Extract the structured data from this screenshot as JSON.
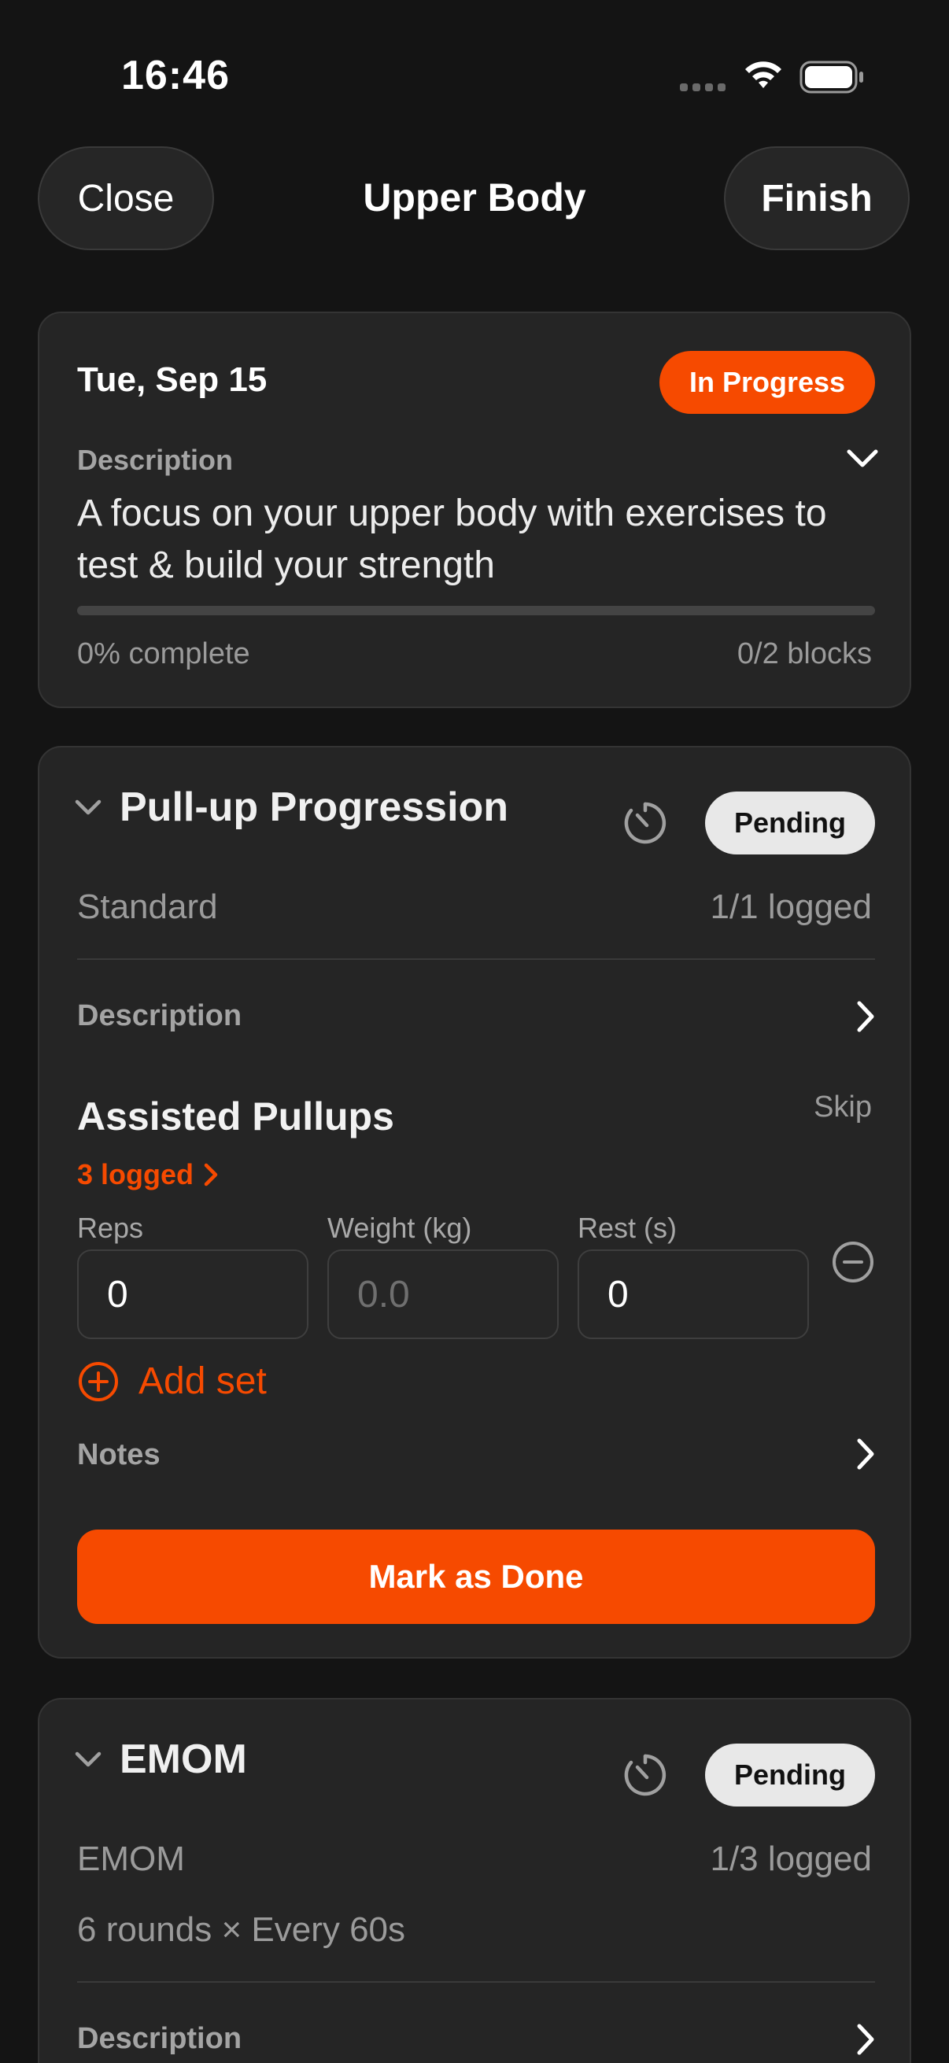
{
  "status_bar": {
    "time": "16:46"
  },
  "nav": {
    "close_label": "Close",
    "title": "Upper Body",
    "finish_label": "Finish"
  },
  "summary": {
    "date": "Tue, Sep 15",
    "status": "In Progress",
    "description_label": "Description",
    "description": "A focus on your upper body with exercises to test & build your strength",
    "progress_fraction": 0,
    "progress_text": "0% complete",
    "blocks_text": "0/2 blocks"
  },
  "blocks": [
    {
      "title": "Pull-up Progression",
      "status": "Pending",
      "type": "Standard",
      "logged": "1/1 logged",
      "description_label": "Description",
      "exercise": {
        "name": "Assisted Pullups",
        "skip_label": "Skip",
        "logged_link": "3 logged",
        "fields": [
          {
            "label": "Reps",
            "value": "0"
          },
          {
            "label": "Weight (kg)",
            "value": "0.0"
          },
          {
            "label": "Rest (s)",
            "value": "0"
          }
        ]
      },
      "add_set_label": "Add set",
      "notes_label": "Notes",
      "mark_done_label": "Mark as Done"
    },
    {
      "title": "EMOM",
      "status": "Pending",
      "type": "EMOM",
      "logged": "1/3 logged",
      "schedule": "6 rounds × Every 60s",
      "description_label": "Description"
    }
  ],
  "colors": {
    "accent": "#f64a00",
    "background": "#141414",
    "card": "#252525"
  },
  "icons": [
    "wifi-icon",
    "battery-icon",
    "chevron-down-icon",
    "chevron-right-icon",
    "timer-icon",
    "minus-circle-icon",
    "plus-circle-icon"
  ]
}
